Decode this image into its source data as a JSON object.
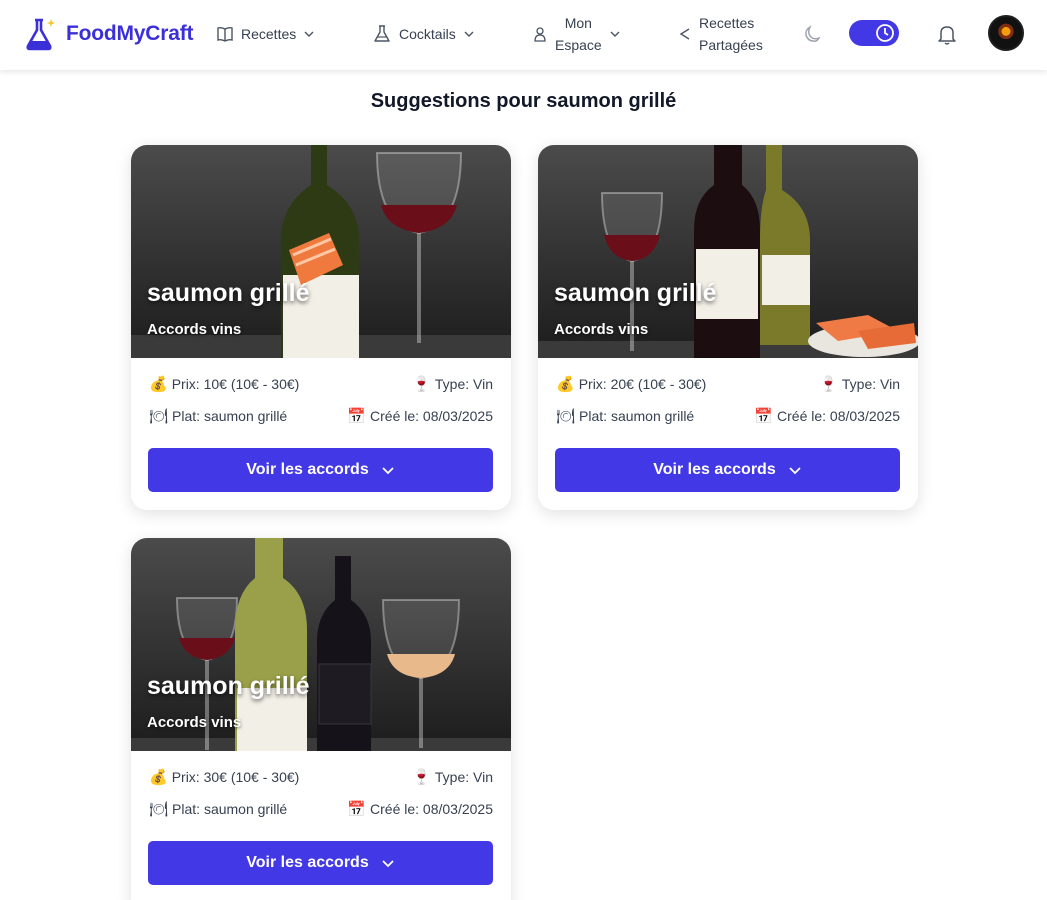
{
  "nav": {
    "brand": "FoodMyCraft",
    "items": [
      {
        "label": "Recettes",
        "icon": "book-icon"
      },
      {
        "label": "Cocktails",
        "icon": "flask-icon"
      },
      {
        "label_line1": "Mon",
        "label_line2": "Espace",
        "icon": "user-icon"
      },
      {
        "label_line1": "Recettes",
        "label_line2": "Partagées",
        "icon": "share-icon"
      }
    ],
    "theme_icon": "moon-icon",
    "toggle_icon": "clock-icon",
    "notification_icon": "bell-icon",
    "accent": "#4338e6"
  },
  "page": {
    "title": "Suggestions pour saumon grillé"
  },
  "cards": [
    {
      "title": "saumon grillé",
      "subtitle": "Accords vins",
      "price": "Prix: 10€ (10€ - 30€)",
      "type": "Type: Vin",
      "dish": "Plat: saumon grillé",
      "created": "Créé le: 08/03/2025",
      "button": "Voir les accords"
    },
    {
      "title": "saumon grillé",
      "subtitle": "Accords vins",
      "price": "Prix: 20€ (10€ - 30€)",
      "type": "Type: Vin",
      "dish": "Plat: saumon grillé",
      "created": "Créé le: 08/03/2025",
      "button": "Voir les accords"
    },
    {
      "title": "saumon grillé",
      "subtitle": "Accords vins",
      "price": "Prix: 30€ (10€ - 30€)",
      "type": "Type: Vin",
      "dish": "Plat: saumon grillé",
      "created": "Créé le: 08/03/2025",
      "button": "Voir les accords"
    }
  ],
  "icons": {
    "price": "💰",
    "type": "🍷",
    "dish": "🍽",
    "created": "📅"
  }
}
